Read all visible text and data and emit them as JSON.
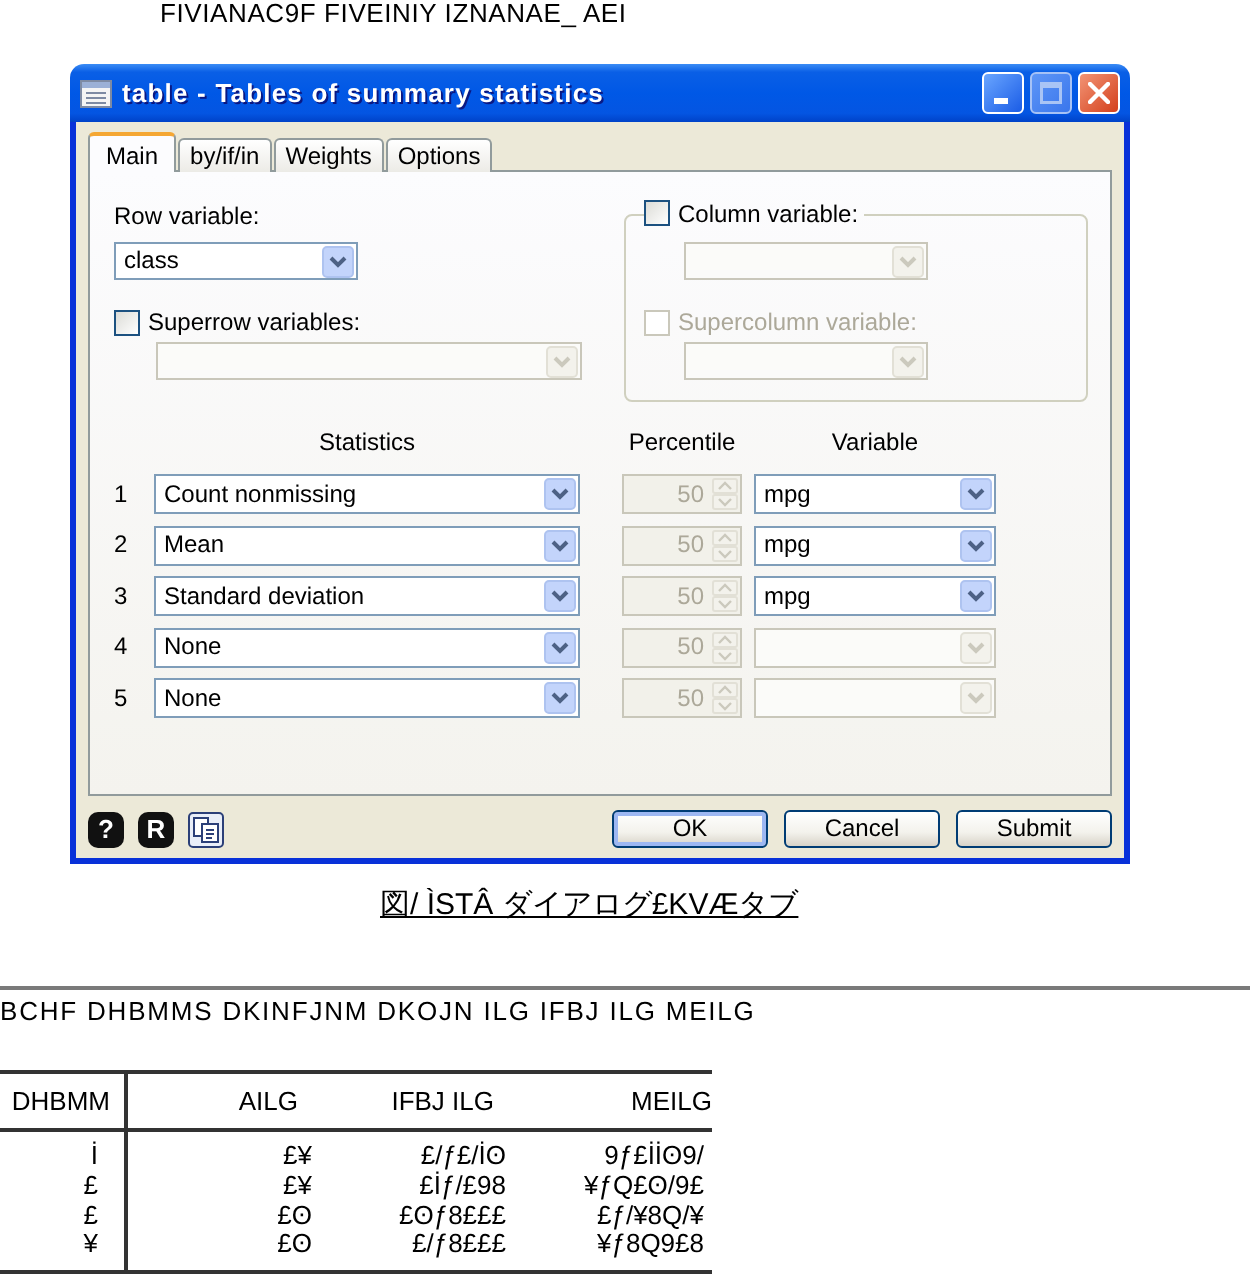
{
  "heading": "FIVIANAC9F FIVEINIY IZNANAE_ AEI",
  "dialog": {
    "title": "table - Tables of summary statistics",
    "window_buttons": [
      {
        "kind": "minimize",
        "disabled": false
      },
      {
        "kind": "maximize",
        "disabled": true
      },
      {
        "kind": "close",
        "disabled": false
      }
    ],
    "tabs": [
      {
        "label": "Main",
        "selected": true
      },
      {
        "label": "by/if/in",
        "selected": false
      },
      {
        "label": "Weights",
        "selected": false
      },
      {
        "label": "Options",
        "selected": false
      }
    ],
    "row_variable": {
      "label": "Row variable:",
      "dropdown": {
        "value": "class",
        "disabled": false
      }
    },
    "superrow": {
      "label": "Superrow variables:",
      "checked": false,
      "disabled": false,
      "dropdown": {
        "disabled": true
      }
    },
    "column_variable": {
      "label": "Column variable:",
      "checked": false,
      "disabled": false,
      "dropdown": {
        "disabled": true
      }
    },
    "supercolumn": {
      "label": "Supercolumn variable:",
      "checked": false,
      "disabled": true,
      "dropdown": {
        "disabled": true
      }
    },
    "headers": {
      "statistics": "Statistics",
      "percentile": "Percentile",
      "variable": "Variable"
    },
    "statistics_rows": [
      {
        "number": "1",
        "statistic": "Count nonmissing",
        "percentile": {
          "value": "50",
          "disabled": true
        },
        "variable": {
          "value": "mpg",
          "disabled": false
        }
      },
      {
        "number": "2",
        "statistic": "Mean",
        "percentile": {
          "value": "50",
          "disabled": true
        },
        "variable": {
          "value": "mpg",
          "disabled": false
        }
      },
      {
        "number": "3",
        "statistic": "Standard deviation",
        "percentile": {
          "value": "50",
          "disabled": true
        },
        "variable": {
          "value": "mpg",
          "disabled": false
        }
      },
      {
        "number": "4",
        "statistic": "None",
        "percentile": {
          "value": "50",
          "disabled": true
        },
        "variable": {
          "disabled": true
        }
      },
      {
        "number": "5",
        "statistic": "None",
        "percentile": {
          "value": "50",
          "disabled": true
        },
        "variable": {
          "disabled": true
        }
      }
    ],
    "footer_tools": [
      {
        "kind": "help",
        "symbol": "?"
      },
      {
        "kind": "reset",
        "symbol": "R"
      },
      {
        "kind": "copy"
      }
    ],
    "buttons": [
      {
        "label": "OK",
        "default": true
      },
      {
        "label": "Cancel",
        "default": false
      },
      {
        "label": "Submit",
        "default": false
      }
    ]
  },
  "figure_caption": "図/ ÌSTÂ ダイアログ£KVÆタブ",
  "paragraph": "BCHF DHBMMS DKINFJNM DKOJN ILG IFBJ ILG MEILG",
  "table": {
    "columns": [
      "DHBMM",
      "AILG",
      "IFBJ ILG",
      "MEILG"
    ],
    "rows": [
      [
        "İ",
        "£¥",
        "£/ƒ£/İʘ",
        "9ƒ£İİʘ9/"
      ],
      [
        "£",
        "£¥",
        "£İƒ/£98",
        "¥ƒQ£ʘ/9£"
      ],
      [
        "£",
        "£ʘ",
        "£ʘƒ8£££",
        "£ƒ/¥8Q/¥"
      ],
      [
        "¥",
        "£ʘ",
        "£/ƒ8£££",
        "¥ƒ8Q9£8"
      ]
    ]
  }
}
